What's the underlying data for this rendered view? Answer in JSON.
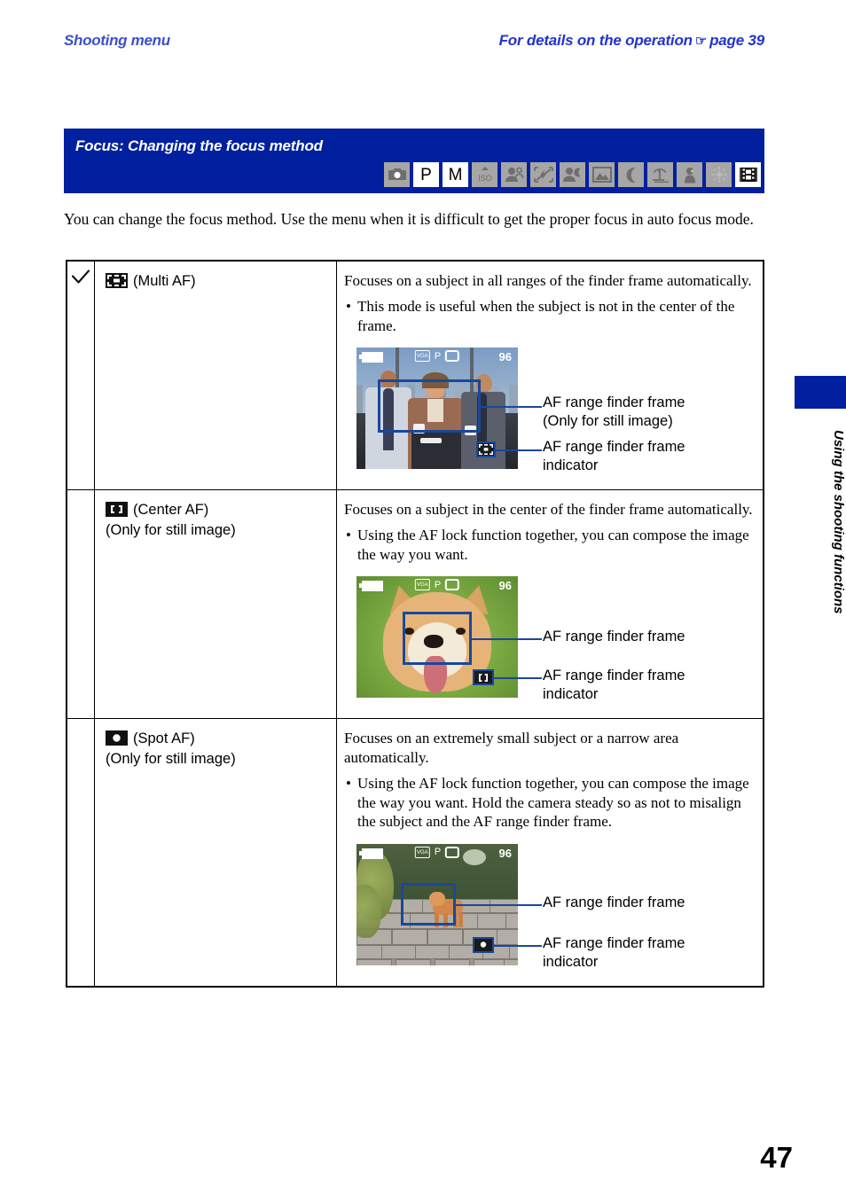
{
  "header": {
    "left": "Shooting menu",
    "right_prefix": "For details on the operation",
    "hand_icon": "☞",
    "right_suffix": "page 39"
  },
  "title_band": {
    "title": "Focus: Changing the focus method",
    "background": "#00209f",
    "mode_icons": [
      {
        "name": "camera-auto-icon",
        "glyph": "",
        "style": "grey",
        "type": "camera"
      },
      {
        "name": "program-mode-icon",
        "glyph": "P",
        "style": "white",
        "type": "text"
      },
      {
        "name": "manual-mode-icon",
        "glyph": "M",
        "style": "white",
        "type": "text"
      },
      {
        "name": "iso-high-sensitivity-icon",
        "glyph": "ISO",
        "style": "grey",
        "type": "iso"
      },
      {
        "name": "soft-snap-mode-icon",
        "glyph": "",
        "style": "grey",
        "type": "people"
      },
      {
        "name": "no-flash-mode-icon",
        "glyph": "",
        "style": "grey",
        "type": "noflash"
      },
      {
        "name": "twilight-portrait-mode-icon",
        "glyph": "",
        "style": "grey",
        "type": "person-moon"
      },
      {
        "name": "landscape-mode-icon",
        "glyph": "",
        "style": "grey",
        "type": "landscape"
      },
      {
        "name": "twilight-mode-icon",
        "glyph": "",
        "style": "grey",
        "type": "moon"
      },
      {
        "name": "beach-mode-icon",
        "glyph": "",
        "style": "grey",
        "type": "beach"
      },
      {
        "name": "snow-mode-icon",
        "glyph": "",
        "style": "grey",
        "type": "snow"
      },
      {
        "name": "fireworks-mode-icon",
        "glyph": "",
        "style": "grey",
        "type": "fireworks"
      },
      {
        "name": "movie-mode-icon",
        "glyph": "",
        "style": "white",
        "type": "movie"
      }
    ]
  },
  "intro": "You can change the focus method. Use the menu when it is difficult to get the proper focus in auto focus mode.",
  "table": {
    "rows": [
      {
        "checked": true,
        "label_line1": "(Multi AF)",
        "label_line2": "",
        "badge": "multi-af-icon",
        "desc": "Focuses on a subject in all ranges of the finder frame automatically.",
        "bullet": "This mode is useful when the subject is not in the center of the frame.",
        "lcd": {
          "battery": "battery-icon",
          "image_size": "VGA",
          "mode": "P",
          "media": "memory-stick-icon",
          "shots": "96",
          "scene": "three-people"
        },
        "callout_frame": "AF range finder frame\n(Only for still image)",
        "callout_indicator": "AF range finder frame\nindicator"
      },
      {
        "checked": false,
        "label_line1": "(Center AF)",
        "label_line2": "(Only for still image)",
        "badge": "center-af-icon",
        "desc": "Focuses on a subject in the center of the finder frame automatically.",
        "bullet": "Using the AF lock function together, you can compose the image the way you want.",
        "lcd": {
          "battery": "battery-icon",
          "image_size": "VGA",
          "mode": "P",
          "media": "memory-stick-icon",
          "shots": "96",
          "scene": "shiba-face"
        },
        "callout_frame": "AF range finder frame",
        "callout_indicator": "AF range finder frame\nindicator"
      },
      {
        "checked": false,
        "label_line1": "(Spot AF)",
        "label_line2": "(Only for still image)",
        "badge": "spot-af-icon",
        "desc": "Focuses on an extremely small subject or a narrow area automatically.",
        "bullet": "Using the AF lock function together, you can compose the image the way you want. Hold the camera steady so as not to misalign the subject and the AF range finder frame.",
        "lcd": {
          "battery": "battery-icon",
          "image_size": "VGA",
          "mode": "P",
          "media": "memory-stick-icon",
          "shots": "96",
          "scene": "dog-on-wall"
        },
        "callout_frame": "AF range finder frame",
        "callout_indicator": "AF range finder frame\nindicator"
      }
    ]
  },
  "side_tab": {
    "text": "Using the shooting functions",
    "block_color": "#00209f"
  },
  "page_number": "47"
}
